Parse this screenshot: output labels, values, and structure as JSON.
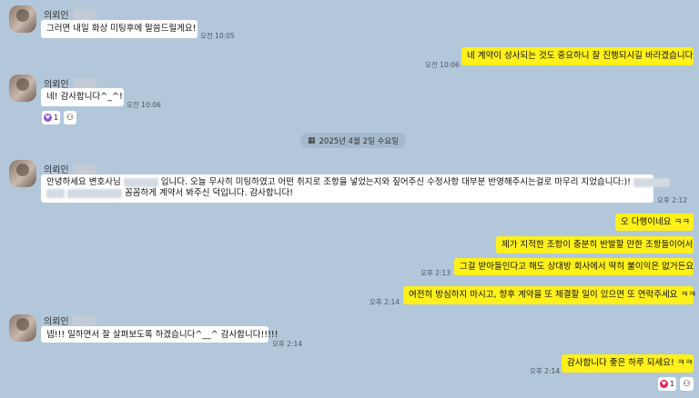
{
  "sender_name": "의뢰인",
  "date_divider": "2025년 4월 2일 수요일",
  "messages": {
    "m1": {
      "text": "그러면 내일 화상 미팅후에 말씀드릴게요!",
      "time": "오전 10:05"
    },
    "m2": {
      "text": "네 계약이 성사되는 것도 중요하니 잘 진행되시길 바라겠습니다",
      "time": "오전 10:06"
    },
    "m3": {
      "text": "네! 감사합니다^_^!",
      "time": "오전 10:06",
      "reaction_count": "1"
    },
    "m4": {
      "line1_a": "안녕하세요 변호사님",
      "line1_b": "입니다. 오늘 무사히 미팅하였고 어떤 취지로 조항을 넣었는지와 짚어주신 수정사항 대부분 반영해주시는걸로 마무리 지었습니다:)!",
      "line2": "꼼꼼하게 계약서 봐주신 덕입니다. 감사합니다!",
      "time": "오후 2:12"
    },
    "m5": {
      "text": "오 다행이네요 ㅋㅋ"
    },
    "m6": {
      "text": "제가 지적한 조항이 충분히 반발할 만한 조항들이어서"
    },
    "m7": {
      "text": "그걸 받아들인다고 해도 상대방 회사에서 딱히 불이익은 없거든요",
      "time": "오후 2:13"
    },
    "m8": {
      "text": "여전히 방심하지 마시고, 향후 계약을 또 체결할 일이 있으면 또 연락주세요 ㅋㅋ",
      "time": "오후 2:14"
    },
    "m9": {
      "text": "넵!!! 일하면서 잘 살펴보도록 하겠습니다^__^ 감사합니다!!!!!",
      "time": "오후 2:14"
    },
    "m10": {
      "text": "감사합니다 좋은 하루 되세요! ㅋㅋ",
      "time": "오후 2:14",
      "reaction_count": "1"
    }
  },
  "colors": {
    "background": "#b2c7da",
    "outgoing": "#fef01b",
    "incoming": "#ffffff"
  }
}
